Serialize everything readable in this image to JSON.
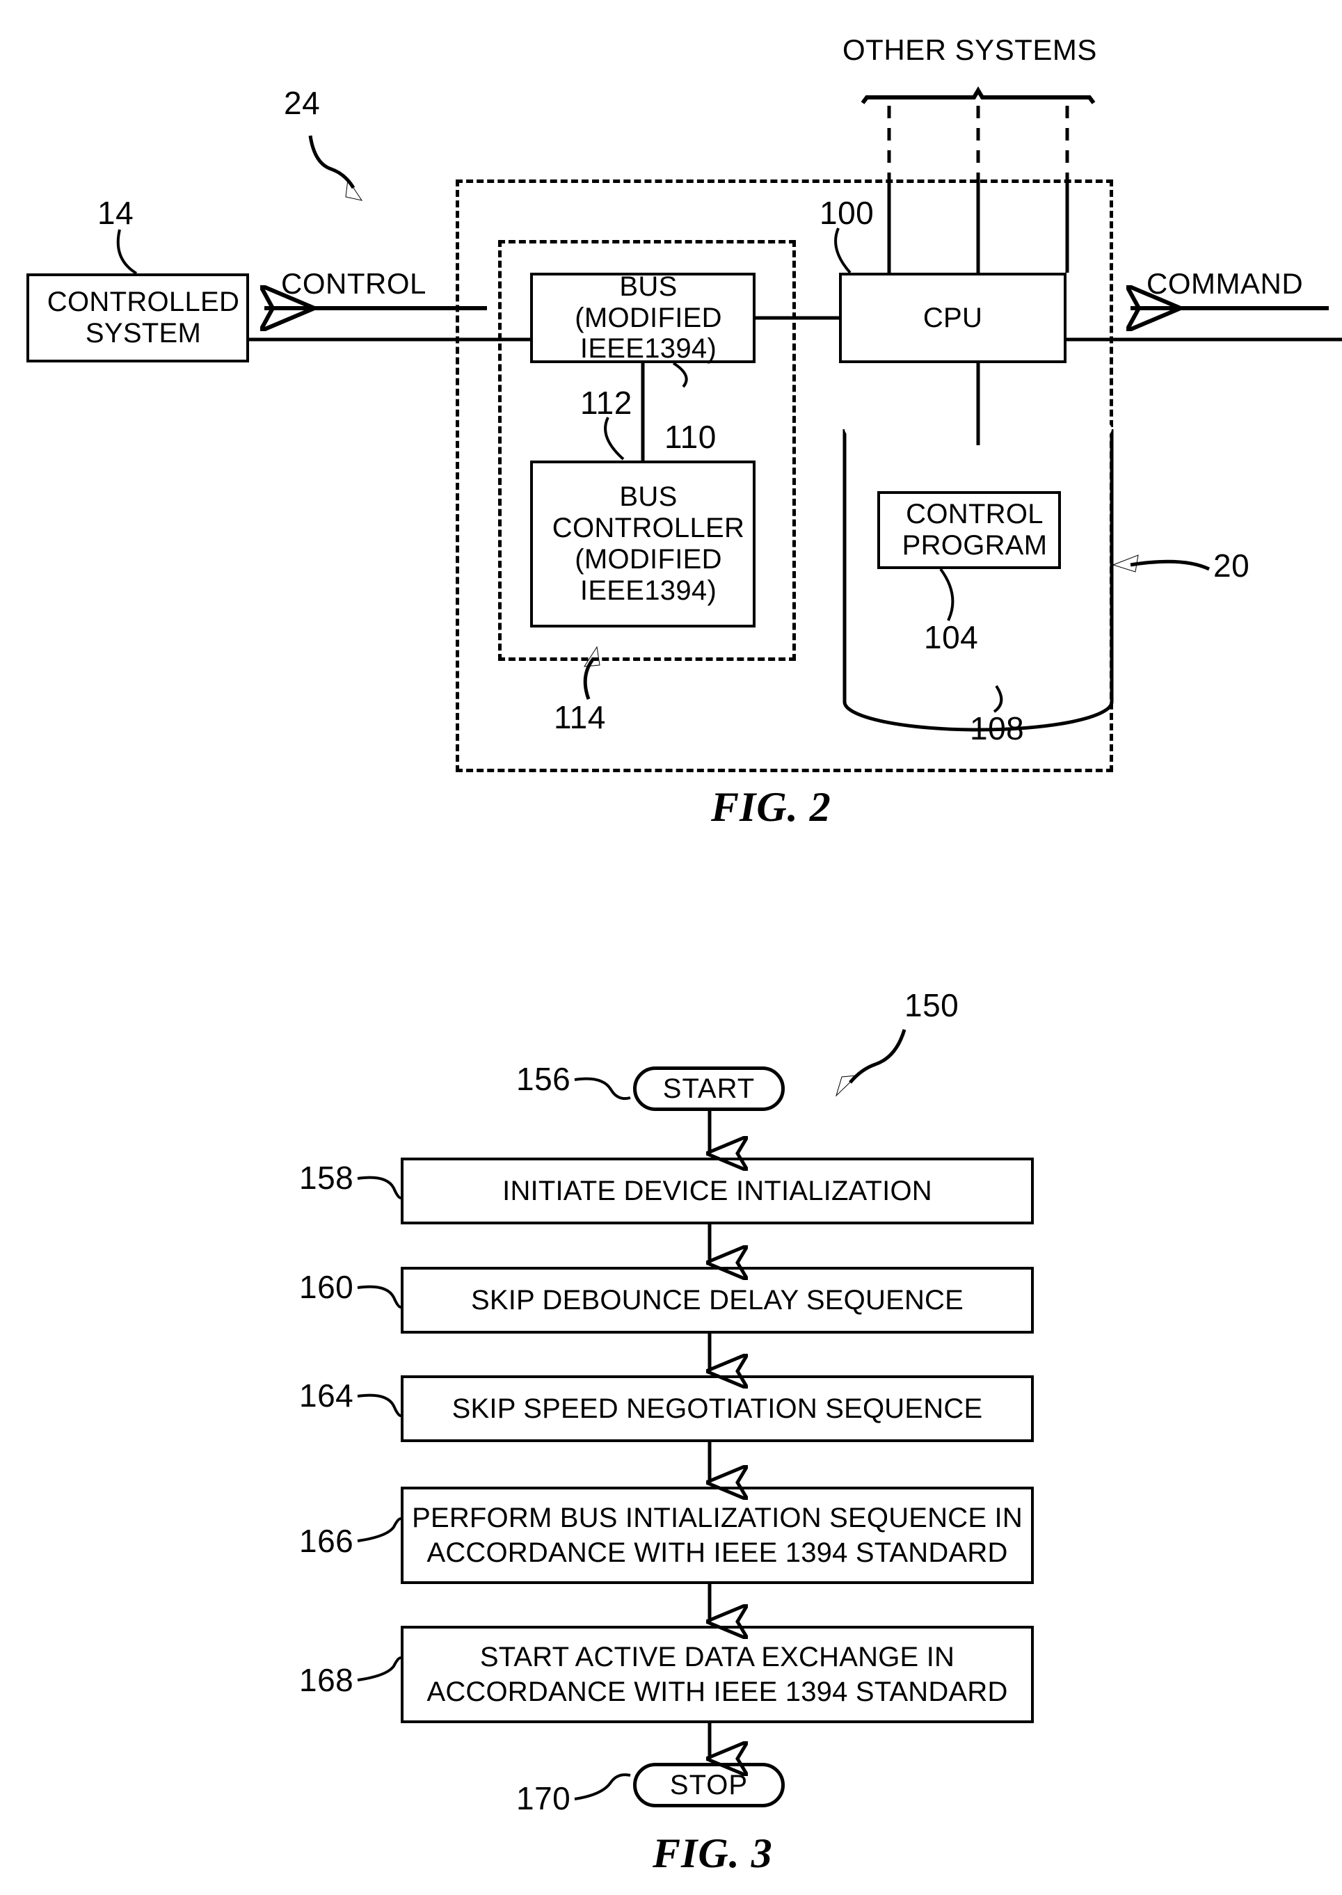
{
  "figure2": {
    "caption": "FIG. 2",
    "labels": {
      "other_systems": "OTHER SYSTEMS",
      "control": "CONTROL",
      "command": "COMMAND"
    },
    "blocks": {
      "controlled_system": "CONTROLLED SYSTEM",
      "controlled_system_line1": "CONTROLLED",
      "controlled_system_line2": "SYSTEM",
      "bus_line1": "BUS (MODIFIED",
      "bus_line2": "IEEE1394)",
      "cpu": "CPU",
      "bus_controller_line1": "BUS",
      "bus_controller_line2": "CONTROLLER",
      "bus_controller_line3": "(MODIFIED",
      "bus_controller_line4": "IEEE1394)",
      "control_program_line1": "CONTROL",
      "control_program_line2": "PROGRAM"
    },
    "refs": {
      "r24": "24",
      "r14": "14",
      "r100": "100",
      "r112": "112",
      "r110": "110",
      "r104": "104",
      "r108": "108",
      "r114": "114",
      "r20": "20"
    }
  },
  "figure3": {
    "caption": "FIG. 3",
    "refs": {
      "r150": "150",
      "r156": "156",
      "r158": "158",
      "r160": "160",
      "r164": "164",
      "r166": "166",
      "r168": "168",
      "r170": "170"
    },
    "start_label": "START",
    "stop_label": "STOP",
    "steps": [
      {
        "ref": "158",
        "line1": "INITIATE DEVICE INTIALIZATION",
        "line2": ""
      },
      {
        "ref": "160",
        "line1": "SKIP DEBOUNCE DELAY SEQUENCE",
        "line2": ""
      },
      {
        "ref": "164",
        "line1": "SKIP SPEED NEGOTIATION SEQUENCE",
        "line2": ""
      },
      {
        "ref": "166",
        "line1": "PERFORM BUS INTIALIZATION SEQUENCE IN",
        "line2": "ACCORDANCE WITH IEEE 1394 STANDARD"
      },
      {
        "ref": "168",
        "line1": "START ACTIVE DATA EXCHANGE IN",
        "line2": "ACCORDANCE WITH IEEE 1394 STANDARD"
      }
    ]
  },
  "colors": {
    "ink": "#000000",
    "paper": "#ffffff"
  }
}
